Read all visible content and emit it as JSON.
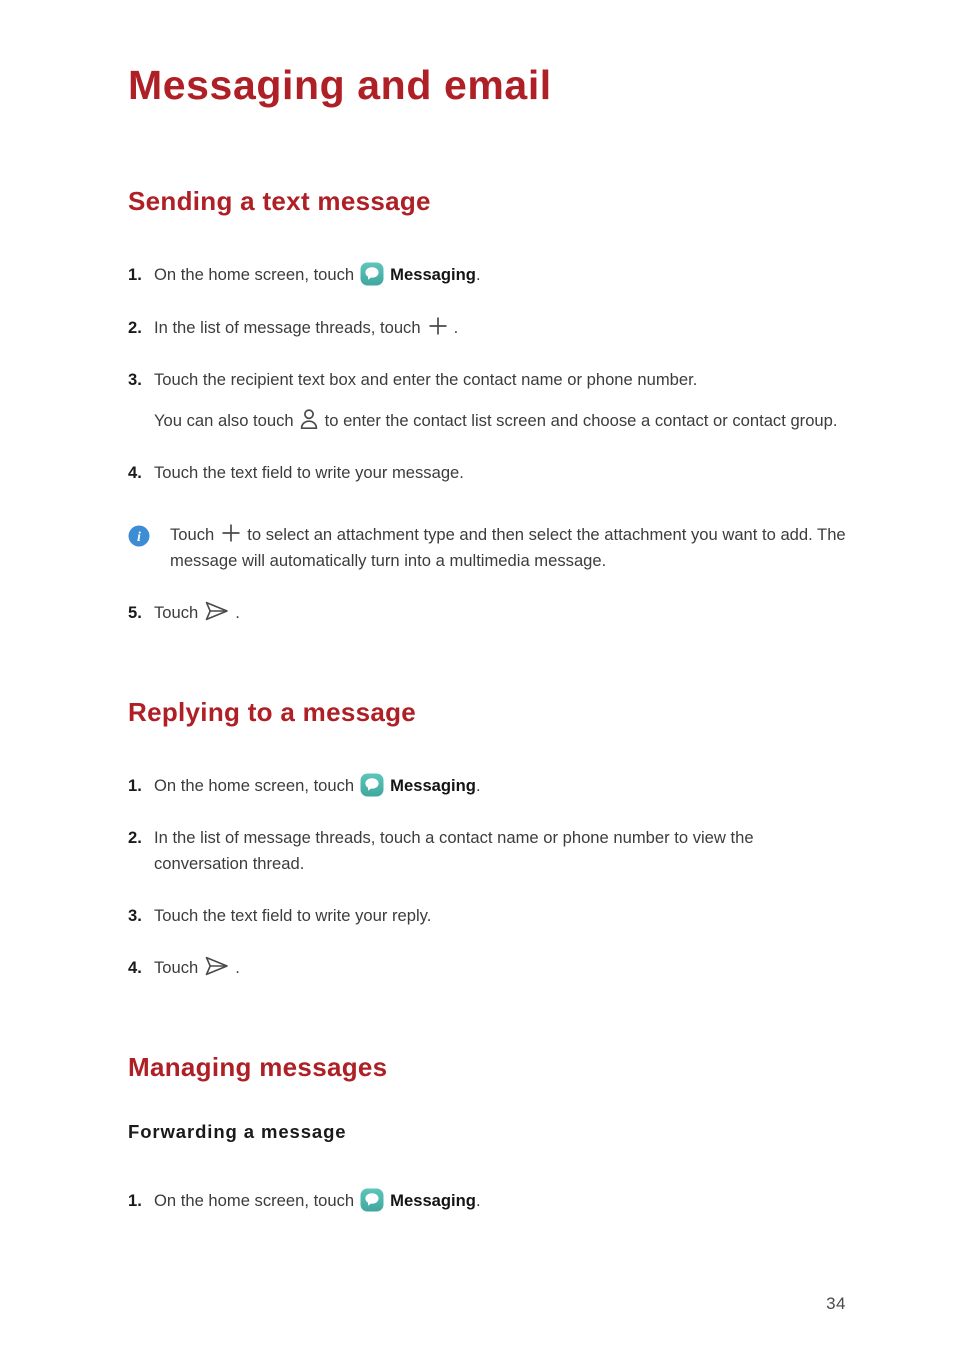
{
  "document": {
    "title": "Messaging and email",
    "page_number": "34"
  },
  "colors": {
    "heading_red": "#AE2026",
    "messaging_icon_teal": "#4DB7AE",
    "info_icon_blue": "#3C8DD4",
    "body_text": "#3c3c3c"
  },
  "sections": [
    {
      "heading": "Sending a text message",
      "steps": [
        {
          "number": "1.",
          "text_before": "On the home screen, touch",
          "icon": "messaging-app-icon",
          "app_name": "Messaging",
          "text_after": "."
        },
        {
          "number": "2.",
          "text_before": "In the list of message threads, touch",
          "icon": "plus-icon",
          "text_after": "."
        },
        {
          "number": "3.",
          "text_before": "Touch the recipient text box and enter the contact name or phone number.",
          "continuation_before": "You can also touch",
          "icon": "contact-person-icon",
          "continuation_after": "to enter the contact list screen and choose a contact or contact group."
        },
        {
          "number": "4.",
          "text_before": "Touch the text field to write your message."
        },
        {
          "number": "5.",
          "text_before": "Touch",
          "icon": "send-arrow-icon",
          "text_after": "."
        }
      ],
      "note": {
        "icon": "info-icon",
        "text_before": "Touch",
        "inline_icon": "plus-icon",
        "text_after": "to select an attachment type and then select the attachment you want to add. The message will automatically turn into a multimedia message."
      }
    },
    {
      "heading": "Replying to a message",
      "steps": [
        {
          "number": "1.",
          "text_before": "On the home screen, touch",
          "icon": "messaging-app-icon",
          "app_name": "Messaging",
          "text_after": "."
        },
        {
          "number": "2.",
          "text_before": "In the list of message threads, touch a contact name or phone number to view the conversation thread."
        },
        {
          "number": "3.",
          "text_before": "Touch the text field to write your reply."
        },
        {
          "number": "4.",
          "text_before": "Touch",
          "icon": "send-arrow-icon",
          "text_after": "."
        }
      ]
    },
    {
      "heading": "Managing messages",
      "subheading": "Forwarding a message",
      "steps": [
        {
          "number": "1.",
          "text_before": "On the home screen, touch",
          "icon": "messaging-app-icon",
          "app_name": "Messaging",
          "text_after": "."
        }
      ]
    }
  ]
}
